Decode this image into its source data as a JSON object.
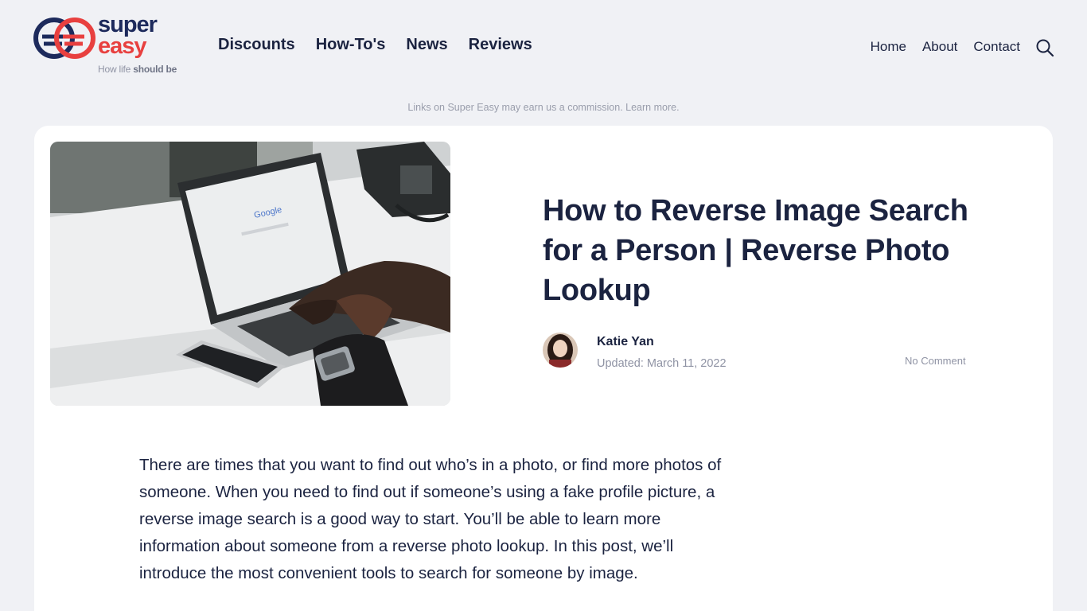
{
  "brand": {
    "word1": "super",
    "word2": "easy",
    "tagline_prefix": "How life ",
    "tagline_bold": "should be"
  },
  "main_nav": [
    {
      "label": "Discounts"
    },
    {
      "label": "How-To's"
    },
    {
      "label": "News"
    },
    {
      "label": "Reviews"
    }
  ],
  "secondary_nav": [
    {
      "label": "Home"
    },
    {
      "label": "About"
    },
    {
      "label": "Contact"
    }
  ],
  "icons": {
    "search": "search-icon",
    "logo": "super-easy-logo-mark"
  },
  "disclosure": "Links on Super Easy may earn us a commission. Learn more.",
  "article": {
    "title": "How to Reverse Image Search for a Person | Reverse Photo Lookup",
    "author": "Katie Yan",
    "updated": "Updated: March 11, 2022",
    "comments": "No Comment",
    "hero_screen_text": "Google",
    "intro": "There are times that you want to find out who’s in a photo, or find more photos of someone. When you need to find out if someone’s using a fake profile picture, a reverse image search is a good way to start. You’ll be able to learn more information about someone from a reverse photo lookup. In this post, we’ll introduce the most convenient tools to search for someone by image."
  },
  "colors": {
    "navy": "#1b2340",
    "brand_blue": "#1d2a5c",
    "brand_red": "#e8403f",
    "page_bg": "#f0f1f5",
    "muted": "#8f93a4"
  }
}
